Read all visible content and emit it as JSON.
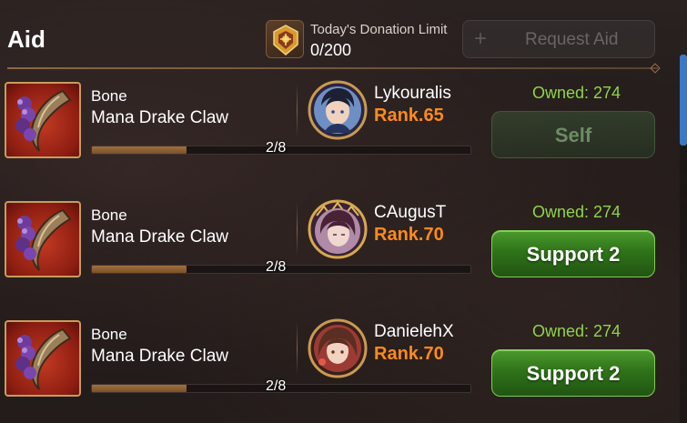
{
  "header": {
    "title": "Aid",
    "donation_label": "Today's Donation Limit",
    "donation_value": "0/200",
    "request_button_label": "Request Aid"
  },
  "rows": [
    {
      "item_name_line1": "Bone",
      "item_name_line2": "Mana Drake Claw",
      "progress_text": "2/8",
      "progress_fraction": 0.25,
      "player_name": "Lykouralis",
      "player_rank": "Rank.65",
      "owned": "Owned: 274",
      "action_label": "Self",
      "action_enabled": false
    },
    {
      "item_name_line1": "Bone",
      "item_name_line2": "Mana Drake Claw",
      "progress_text": "2/8",
      "progress_fraction": 0.25,
      "player_name": "CAugusT",
      "player_rank": "Rank.70",
      "owned": "Owned: 274",
      "action_label": "Support 2",
      "action_enabled": true
    },
    {
      "item_name_line1": "Bone",
      "item_name_line2": "Mana Drake Claw",
      "progress_text": "2/8",
      "progress_fraction": 0.25,
      "player_name": "DanielehX",
      "player_rank": "Rank.70",
      "owned": "Owned: 274",
      "action_label": "Support 2",
      "action_enabled": true
    }
  ],
  "icons": {
    "donation": "guild-emblem-icon",
    "item": "claw-icon",
    "plus": "plus-icon"
  },
  "colors": {
    "rank": "#ff8a1c",
    "owned": "#8fd44a",
    "button_green": "#2f7319",
    "item_bg": "#8d1d12"
  }
}
